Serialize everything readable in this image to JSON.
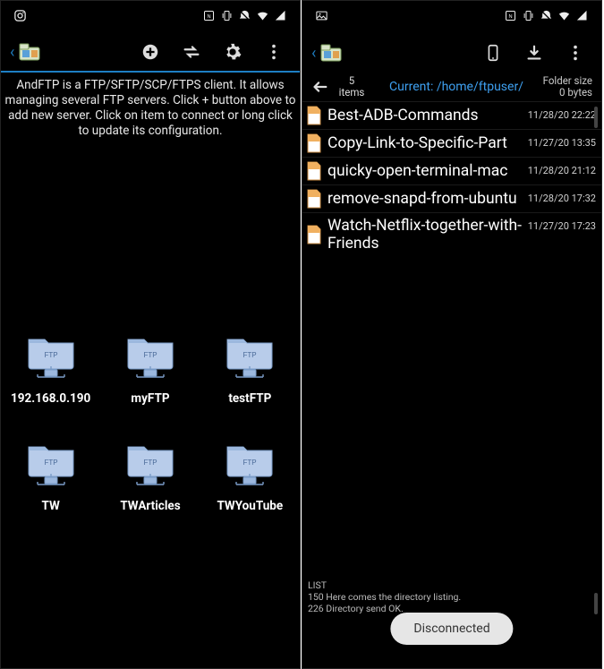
{
  "status_icons": [
    "nfc",
    "vibrate",
    "dnd",
    "wifi",
    "signal"
  ],
  "left": {
    "status_left_icon": "instagram",
    "toolbar": {
      "add_icon": "plus-circle",
      "swap_icon": "swap",
      "settings_icon": "gear",
      "overflow_icon": "more-vert"
    },
    "description": "AndFTP is a FTP/SFTP/SCP/FTPS client. It allows managing several FTP servers. Click + button above to add new server. Click on item to connect or long click to update its configuration.",
    "servers": [
      {
        "label": "192.168.0.190"
      },
      {
        "label": "myFTP"
      },
      {
        "label": "testFTP"
      },
      {
        "label": "TW"
      },
      {
        "label": "TWArticles"
      },
      {
        "label": "TWYouTube"
      }
    ]
  },
  "right": {
    "status_left_icon": "image",
    "toolbar": {
      "device_icon": "phone",
      "download_icon": "download",
      "overflow_icon": "more-vert"
    },
    "header": {
      "items_count_line1": "5",
      "items_count_line2": "items",
      "path_prefix": "Current: ",
      "path": "/home/ftpuser/",
      "size_line1": "Folder size",
      "size_line2": "0 bytes"
    },
    "files": [
      {
        "name": "Best-ADB-Commands",
        "date": "11/28/20 22:22"
      },
      {
        "name": "Copy-Link-to-Specific-Part",
        "date": "11/27/20 13:35"
      },
      {
        "name": "quicky-open-terminal-mac",
        "date": "11/28/20 21:12"
      },
      {
        "name": "remove-snapd-from-ubuntu",
        "date": "11/28/20 17:32"
      },
      {
        "name": "Watch-Netflix-together-with-Friends",
        "date": "11/27/20 17:23"
      }
    ],
    "log_lines": [
      "LIST",
      "150 Here comes the directory listing.",
      "226 Directory send OK."
    ],
    "toast": "Disconnected"
  }
}
